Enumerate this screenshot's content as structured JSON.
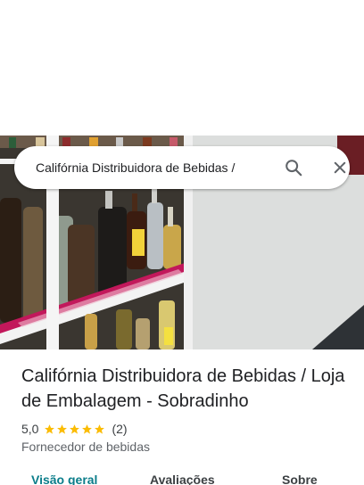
{
  "search": {
    "query": "Califórnia Distribuidora de Bebidas /",
    "search_icon": "search-icon",
    "close_icon": "close-icon"
  },
  "place": {
    "title": "Califórnia Distribuidora de Bebidas / Loja de Embalagem - Sobradinho",
    "rating": "5,0",
    "stars": 5,
    "star_color": "#fbbc04",
    "review_count": "(2)",
    "category": "Fornecedor de bebidas"
  },
  "tabs": [
    {
      "label": "Visão geral",
      "active": true
    },
    {
      "label": "Avaliações",
      "active": false
    },
    {
      "label": "Sobre",
      "active": false
    }
  ],
  "colors": {
    "active_tab": "#0b7d8a",
    "shelf_cloth": "#c2185b"
  }
}
